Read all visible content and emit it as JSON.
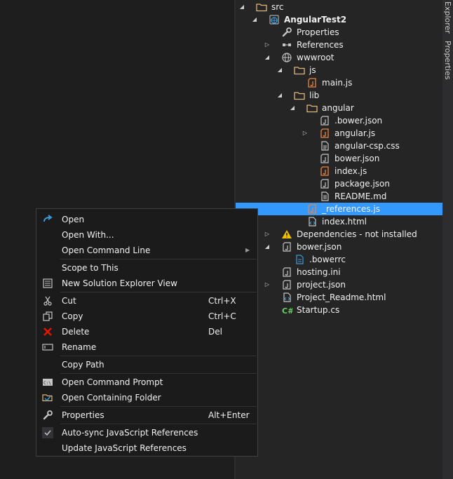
{
  "vertical_tabs": [
    "Explorer",
    "Properties"
  ],
  "tree": [
    {
      "label": "src",
      "icon": "folder-icon",
      "arrow": "expanded",
      "bold": false
    },
    {
      "label": "AngularTest2",
      "icon": "web-project-icon",
      "arrow": "expanded",
      "bold": true
    },
    {
      "label": "Properties",
      "icon": "wrench-icon",
      "arrow": "none",
      "bold": false
    },
    {
      "label": "References",
      "icon": "references-icon",
      "arrow": "collapsed",
      "bold": false
    },
    {
      "label": "wwwroot",
      "icon": "globe-icon",
      "arrow": "expanded",
      "bold": false
    },
    {
      "label": "js",
      "icon": "folder-icon",
      "arrow": "expanded",
      "bold": false
    },
    {
      "label": "main.js",
      "icon": "js-file-icon",
      "arrow": "none",
      "bold": false
    },
    {
      "label": "lib",
      "icon": "folder-icon",
      "arrow": "expanded",
      "bold": false
    },
    {
      "label": "angular",
      "icon": "folder-icon",
      "arrow": "expanded",
      "bold": false
    },
    {
      "label": ".bower.json",
      "icon": "json-file-icon",
      "arrow": "none",
      "bold": false
    },
    {
      "label": "angular.js",
      "icon": "js-file-icon",
      "arrow": "collapsed",
      "bold": false
    },
    {
      "label": "angular-csp.css",
      "icon": "css-file-icon",
      "arrow": "none",
      "bold": false
    },
    {
      "label": "bower.json",
      "icon": "json-file-icon",
      "arrow": "none",
      "bold": false
    },
    {
      "label": "index.js",
      "icon": "js-file-icon",
      "arrow": "none",
      "bold": false
    },
    {
      "label": "package.json",
      "icon": "json-file-icon",
      "arrow": "none",
      "bold": false
    },
    {
      "label": "README.md",
      "icon": "text-file-icon",
      "arrow": "none",
      "bold": false
    },
    {
      "label": "_references.js",
      "icon": "js-file-icon",
      "arrow": "none",
      "bold": false,
      "selected": true
    },
    {
      "label": "index.html",
      "icon": "html-file-icon",
      "arrow": "none",
      "bold": false
    },
    {
      "label": "Dependencies - not installed",
      "icon": "warning-icon",
      "arrow": "collapsed",
      "bold": false
    },
    {
      "label": "bower.json",
      "icon": "json-file-icon",
      "arrow": "expanded",
      "bold": false
    },
    {
      "label": ".bowerrc",
      "icon": "config-file-icon",
      "arrow": "none",
      "bold": false
    },
    {
      "label": "hosting.ini",
      "icon": "json-file-icon",
      "arrow": "none",
      "bold": false
    },
    {
      "label": "project.json",
      "icon": "json-file-icon",
      "arrow": "collapsed",
      "bold": false
    },
    {
      "label": "Project_Readme.html",
      "icon": "html-file-icon",
      "arrow": "none",
      "bold": false
    },
    {
      "label": "Startup.cs",
      "icon": "csharp-file-icon",
      "arrow": "none",
      "bold": false
    }
  ],
  "context_menu": {
    "groups": [
      [
        {
          "label": "Open",
          "icon": "open-arrow-icon",
          "shortcut": ""
        },
        {
          "label": "Open With...",
          "icon": "",
          "shortcut": ""
        },
        {
          "label": "Open Command Line",
          "icon": "",
          "shortcut": "",
          "submenu": true
        }
      ],
      [
        {
          "label": "Scope to This",
          "icon": "",
          "shortcut": ""
        },
        {
          "label": "New Solution Explorer View",
          "icon": "solution-explorer-icon",
          "shortcut": ""
        }
      ],
      [
        {
          "label": "Cut",
          "icon": "scissors-icon",
          "shortcut": "Ctrl+X"
        },
        {
          "label": "Copy",
          "icon": "copy-icon",
          "shortcut": "Ctrl+C"
        },
        {
          "label": "Delete",
          "icon": "delete-x-icon",
          "shortcut": "Del"
        },
        {
          "label": "Rename",
          "icon": "rename-icon",
          "shortcut": ""
        }
      ],
      [
        {
          "label": "Copy Path",
          "icon": "",
          "shortcut": ""
        }
      ],
      [
        {
          "label": "Open Command Prompt",
          "icon": "command-prompt-icon",
          "shortcut": ""
        },
        {
          "label": "Open Containing Folder",
          "icon": "open-folder-icon",
          "shortcut": ""
        }
      ],
      [
        {
          "label": "Properties",
          "icon": "wrench-icon",
          "shortcut": "Alt+Enter"
        }
      ],
      [
        {
          "label": "Auto-sync JavaScript References",
          "icon": "checkmark-icon",
          "shortcut": ""
        },
        {
          "label": "Update JavaScript References",
          "icon": "",
          "shortcut": ""
        }
      ]
    ]
  }
}
